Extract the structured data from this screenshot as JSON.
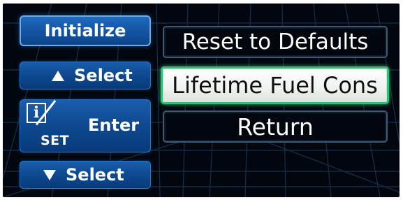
{
  "left_panel": {
    "initialize_label": "Initialize",
    "select_up_label": "Select",
    "enter_label": "Enter",
    "set_icon_letter": "i",
    "set_icon_text": "SET",
    "select_down_label": "Select"
  },
  "menu": {
    "items": [
      {
        "label": "Reset to Defaults",
        "selected": false
      },
      {
        "label": "Lifetime Fuel Cons",
        "selected": true
      },
      {
        "label": "Return",
        "selected": false
      }
    ]
  },
  "colors": {
    "background": "#02070f",
    "button_blue": "#0f4a92",
    "selection_green": "#2fbf76",
    "grid_line": "#1a3550"
  },
  "icons": {
    "up": "triangle-up-icon",
    "down": "triangle-down-icon",
    "set": "info-set-icon"
  }
}
